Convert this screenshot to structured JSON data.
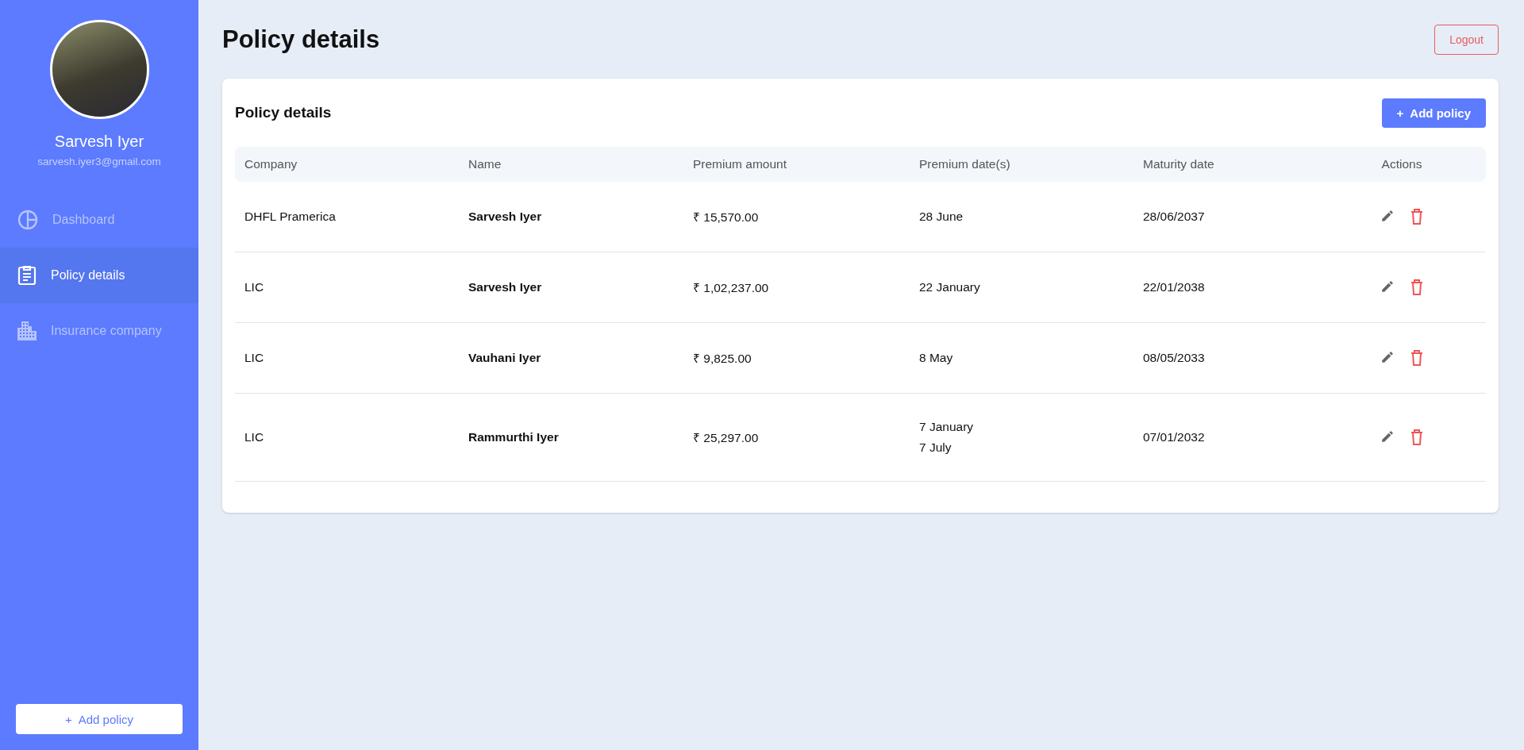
{
  "sidebar": {
    "user": {
      "name": "Sarvesh Iyer",
      "email": "sarvesh.iyer3@gmail.com"
    },
    "items": [
      {
        "kind": "dashboard",
        "label": "Dashboard",
        "selected": false
      },
      {
        "kind": "policies",
        "label": "Policy details",
        "selected": true
      },
      {
        "kind": "companies",
        "label": "Insurance company",
        "selected": false
      }
    ],
    "add_button": {
      "icon": "+",
      "label": "Add policy"
    }
  },
  "header": {
    "title": "Policy details",
    "logout": "Logout"
  },
  "card": {
    "title": "Policy details",
    "add_button": {
      "icon": "+",
      "label": "Add policy"
    },
    "table": {
      "columns": [
        "Company",
        "Name",
        "Premium amount",
        "Premium date(s)",
        "Maturity date",
        "Actions"
      ],
      "rows": [
        {
          "company": "DHFL Pramerica",
          "name": "Sarvesh Iyer",
          "premium_amount": "₹ 15,570.00",
          "premium_dates": [
            "28 June"
          ],
          "maturity_date": "28/06/2037"
        },
        {
          "company": "LIC",
          "name": "Sarvesh Iyer",
          "premium_amount": "₹ 1,02,237.00",
          "premium_dates": [
            "22 January"
          ],
          "maturity_date": "22/01/2038"
        },
        {
          "company": "LIC",
          "name": "Vauhani Iyer",
          "premium_amount": "₹ 9,825.00",
          "premium_dates": [
            "8 May"
          ],
          "maturity_date": "08/05/2033"
        },
        {
          "company": "LIC",
          "name": "Rammurthi Iyer",
          "premium_amount": "₹ 25,297.00",
          "premium_dates": [
            "7 January",
            "7 July"
          ],
          "maturity_date": "07/01/2032"
        }
      ]
    }
  }
}
